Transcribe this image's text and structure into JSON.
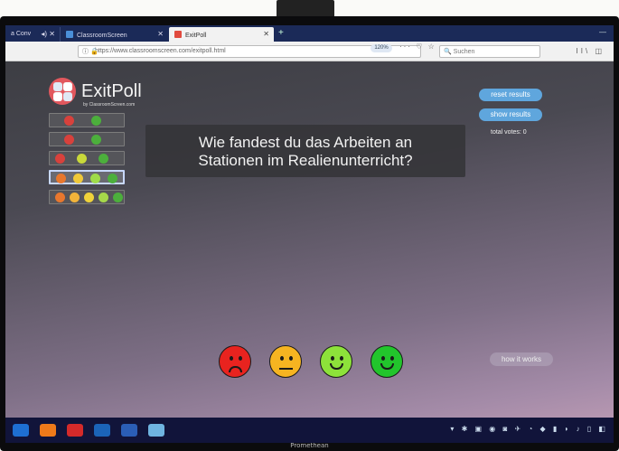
{
  "browser": {
    "tabs": [
      {
        "label": "a Conv",
        "icon": "speaker-icon"
      },
      {
        "label": "ClassroomScreen",
        "icon": "grid-icon"
      },
      {
        "label": "ExitPoll",
        "icon": "exitpoll-icon",
        "active": true
      }
    ],
    "new_tab": "+",
    "url": "https://www.classroomscreen.com/exitpoll.html",
    "zoom": "120%",
    "url_tools": "··· ♡ ☆",
    "search_placeholder": "Suchen",
    "right_tools": "II\\ ◫"
  },
  "app": {
    "logo": {
      "title": "ExitPoll",
      "subtitle": "by ClassroomScreen.com"
    },
    "question_lines": [
      "Wie fandest du das Arbeiten an",
      "Stationen im Realienunterricht?"
    ],
    "reset_label": "reset results",
    "show_label": "show results",
    "total_votes_label": "total votes: 0",
    "how_label": "how it works",
    "answer_sets": [
      {
        "options": [
          "cross",
          "check"
        ],
        "colors": [
          "#d8413c",
          "#4caf3c"
        ]
      },
      {
        "options": [
          "sad",
          "happy"
        ],
        "colors": [
          "#d8413c",
          "#4caf3c"
        ]
      },
      {
        "options": [
          "sad",
          "neutral",
          "happy"
        ],
        "colors": [
          "#d8413c",
          "#c9d93a",
          "#4caf3c"
        ]
      },
      {
        "options": [
          "sad",
          "neutral",
          "smile",
          "happy"
        ],
        "colors": [
          "#e8772e",
          "#f0c93a",
          "#9fdc4a",
          "#4caf3c"
        ],
        "selected": true
      },
      {
        "options": [
          "very-sad",
          "sad",
          "neutral",
          "smile",
          "happy"
        ],
        "colors": [
          "#e8772e",
          "#f2b43a",
          "#f0d33a",
          "#a6d94a",
          "#4caf3c"
        ]
      }
    ],
    "vote_faces": [
      {
        "name": "sad-face",
        "color": "#e8231f",
        "mouth": "sad"
      },
      {
        "name": "neutral-face",
        "color": "#f6b421",
        "mouth": "flat"
      },
      {
        "name": "smile-face",
        "color": "#8de23a",
        "mouth": "smile"
      },
      {
        "name": "happy-face",
        "color": "#22c52c",
        "mouth": "smile"
      }
    ]
  },
  "monitor_brand": "Promethean",
  "taskbar": {
    "apps": [
      "ie-icon",
      "firefox-icon",
      "opera-icon",
      "outlook-icon",
      "word-icon",
      "explorer-icon"
    ],
    "tray": "▾ ✱ ▣ ◉ ◙ ✈ ◔ ◆ ▮ ◗ ♪ ▯ ◧"
  }
}
